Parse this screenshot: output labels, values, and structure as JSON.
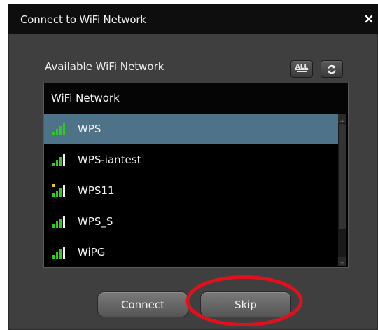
{
  "dialog": {
    "title": "Connect to WiFi Network",
    "close_icon": "close-icon"
  },
  "section": {
    "label": "Available WiFi Network",
    "show_all_icon": "show-all-icon",
    "show_all_text": "ALL",
    "refresh_icon": "refresh-icon"
  },
  "list": {
    "header": "WiFi Network",
    "networks": [
      {
        "name": "WPS",
        "signal_bars": 4,
        "selected": true,
        "secured": false
      },
      {
        "name": "WPS-iantest",
        "signal_bars": 3,
        "selected": false,
        "secured": false
      },
      {
        "name": "WPS11",
        "signal_bars": 3,
        "selected": false,
        "secured": true
      },
      {
        "name": "WPS_S",
        "signal_bars": 3,
        "selected": false,
        "secured": false
      },
      {
        "name": "WiPG",
        "signal_bars": 3,
        "selected": false,
        "secured": false
      }
    ]
  },
  "buttons": {
    "connect": "Connect",
    "skip": "Skip"
  },
  "colors": {
    "selected_row": "#4e7389",
    "signal_green": "#2ecc1f",
    "annotation_red": "#e0101c"
  }
}
